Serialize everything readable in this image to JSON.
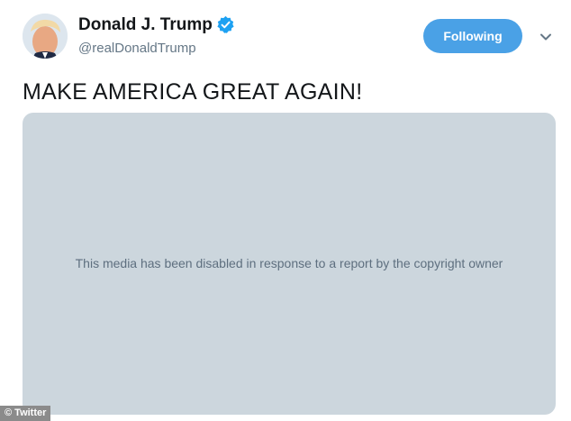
{
  "tweet": {
    "author": {
      "display_name": "Donald J. Trump",
      "handle": "@realDonaldTrump",
      "verified": true
    },
    "follow_button_label": "Following",
    "text": "MAKE AMERICA GREAT AGAIN!",
    "media": {
      "notice": "This media has been disabled in response to a report by the copyright owner"
    }
  },
  "watermark": {
    "credit": "© Twitter"
  },
  "colors": {
    "follow_button": "#4aa1e6",
    "verified_badge": "#1da1f2",
    "media_placeholder": "#ccd6dd"
  },
  "icons": {
    "verified": "verified-badge-icon",
    "menu": "chevron-down-icon"
  }
}
